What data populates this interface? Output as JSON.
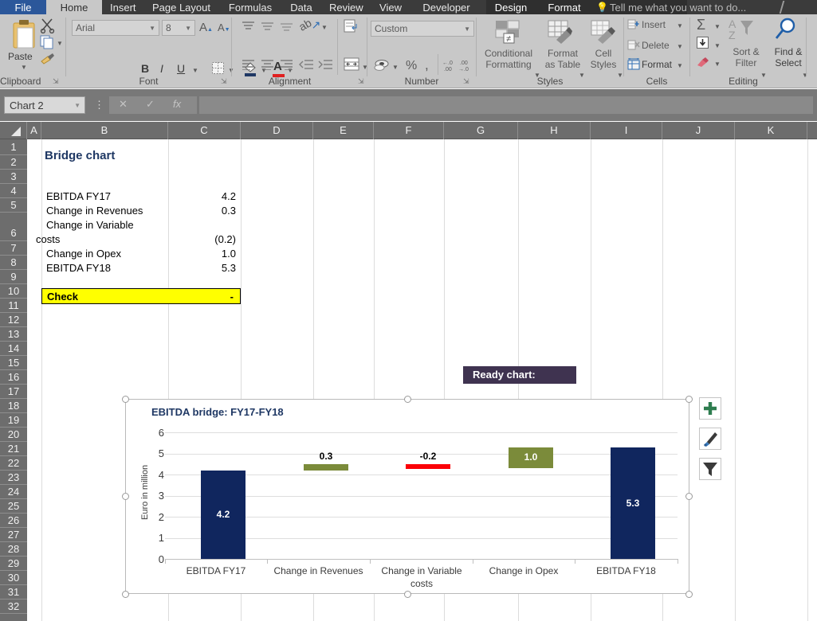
{
  "ribbon": {
    "tabs": [
      {
        "label": "File",
        "state": "file"
      },
      {
        "label": "Home",
        "state": "active"
      },
      {
        "label": "Insert",
        "state": "normal"
      },
      {
        "label": "Page Layout",
        "state": "normal"
      },
      {
        "label": "Formulas",
        "state": "normal"
      },
      {
        "label": "Data",
        "state": "normal"
      },
      {
        "label": "Review",
        "state": "normal"
      },
      {
        "label": "View",
        "state": "normal"
      },
      {
        "label": "Developer",
        "state": "normal"
      },
      {
        "label": "Design",
        "state": "contextual"
      },
      {
        "label": "Format",
        "state": "contextual"
      }
    ],
    "tell_me": "Tell me what you want to do...",
    "groups": {
      "clipboard": {
        "name": "Clipboard",
        "paste_label": "Paste"
      },
      "font": {
        "name": "Font",
        "font_name": "Arial",
        "font_size": "8",
        "bold": "B",
        "italic": "I",
        "underline": "U",
        "grow_font": "A",
        "shrink_font": "A"
      },
      "alignment": {
        "name": "Alignment"
      },
      "number": {
        "name": "Number",
        "format": "Custom",
        "percent": "%",
        "comma": ","
      },
      "styles": {
        "name": "Styles",
        "conditional_formatting": "Conditional Formatting",
        "format_as_table": "Format as Table",
        "cell_styles": "Cell Styles"
      },
      "cells": {
        "name": "Cells",
        "insert": "Insert",
        "delete": "Delete",
        "format": "Format"
      },
      "editing": {
        "name": "Editing",
        "autosum": "Σ",
        "sort_filter": "Sort & Filter",
        "find_select": "Find & Select"
      }
    }
  },
  "formula_bar": {
    "name_box": "Chart 2",
    "cancel": "✕",
    "enter": "✓",
    "fx": "fx",
    "formula": ""
  },
  "grid": {
    "columns": [
      "A",
      "B",
      "C",
      "D",
      "E",
      "F",
      "G",
      "H",
      "I",
      "J",
      "K"
    ],
    "rows": [
      "1",
      "2",
      "3",
      "4",
      "5",
      "6",
      "7",
      "8",
      "9",
      "10",
      "11",
      "12",
      "13",
      "14",
      "15",
      "16",
      "17",
      "18",
      "19",
      "20",
      "21",
      "22",
      "23",
      "24",
      "25",
      "26",
      "27",
      "28",
      "29",
      "30",
      "31",
      "32"
    ],
    "cells": {
      "title": "Bridge chart",
      "items": [
        {
          "label": "EBITDA FY17",
          "value": "4.2"
        },
        {
          "label": "Change in Revenues",
          "value": "0.3"
        },
        {
          "label": "Change in Variable",
          "value": ""
        },
        {
          "label": "costs",
          "value": "(0.2)"
        },
        {
          "label": "Change in Opex",
          "value": "1.0"
        },
        {
          "label": "EBITDA FY18",
          "value": "5.3"
        }
      ],
      "check_label": "Check",
      "check_value": "-"
    }
  },
  "ready_chart_label": "Ready chart:",
  "chart_data": {
    "type": "bar",
    "chart_kind": "waterfall-bridge",
    "title": "EBITDA bridge: FY17-FY18",
    "xlabel": "",
    "ylabel": "Euro in million",
    "ylim": [
      0,
      6
    ],
    "yticks": [
      0,
      1,
      2,
      3,
      4,
      5,
      6
    ],
    "grid": true,
    "legend": false,
    "categories": [
      "EBITDA FY17",
      "Change in Revenues",
      "Change in Variable costs",
      "Change in Opex",
      "EBITDA FY18"
    ],
    "values": [
      4.2,
      0.3,
      -0.2,
      1.0,
      5.3
    ],
    "labels": [
      "4.2",
      "0.3",
      "-0.2",
      "1.0",
      "5.3"
    ],
    "bars": [
      {
        "category": "EBITDA FY17",
        "label": "4.2",
        "base": 0.0,
        "top": 4.2,
        "color": "#10265e",
        "label_pos": "inside",
        "label_color": "#ffffff"
      },
      {
        "category": "Change in Revenues",
        "label": "0.3",
        "base": 4.2,
        "top": 4.5,
        "color": "#7b8b3a",
        "label_pos": "outside",
        "label_color": "#000000"
      },
      {
        "category": "Change in Variable costs",
        "label": "-0.2",
        "base": 4.3,
        "top": 4.5,
        "color": "#fb0007",
        "label_pos": "outside",
        "label_color": "#000000"
      },
      {
        "category": "Change in Opex",
        "label": "1.0",
        "base": 4.3,
        "top": 5.3,
        "color": "#7b8b3a",
        "label_pos": "inside",
        "label_color": "#ffffff"
      },
      {
        "category": "EBITDA FY18",
        "label": "5.3",
        "base": 0.0,
        "top": 5.3,
        "color": "#10265e",
        "label_pos": "inside",
        "label_color": "#ffffff"
      }
    ],
    "colors": {
      "total": "#10265e",
      "increase": "#7b8b3a",
      "decrease": "#fb0007",
      "gridline": "#dedede",
      "title": "#1f3864"
    }
  },
  "chart_tools": [
    {
      "icon": "plus-icon",
      "name": "chart-elements"
    },
    {
      "icon": "brush-icon",
      "name": "chart-styles"
    },
    {
      "icon": "funnel-icon",
      "name": "chart-filters"
    }
  ]
}
